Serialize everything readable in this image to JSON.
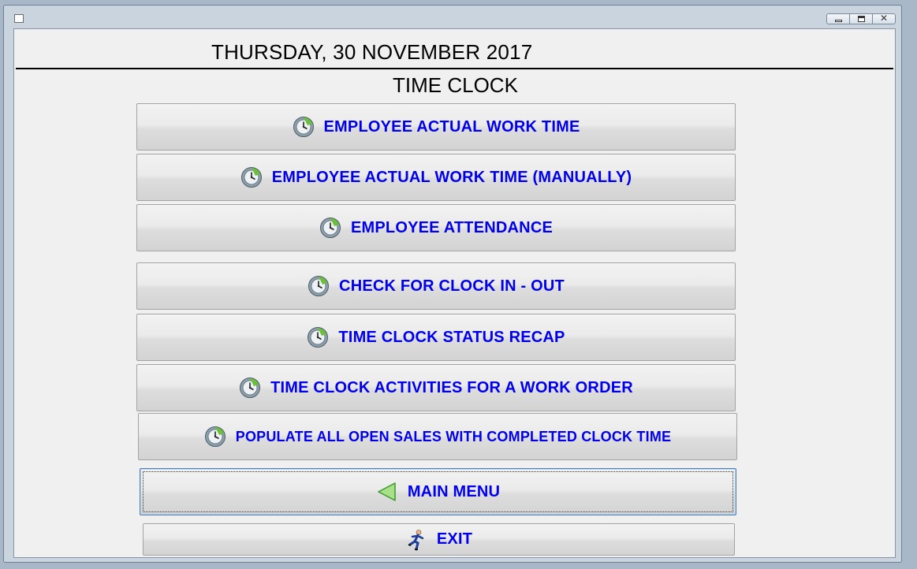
{
  "window": {
    "minimize_icon": "minimize-icon",
    "maximize_icon": "maximize-icon",
    "close_glyph": "✕"
  },
  "header": {
    "date": "THURSDAY, 30 NOVEMBER 2017",
    "title": "TIME CLOCK"
  },
  "menu": {
    "items": [
      {
        "label": "EMPLOYEE ACTUAL WORK TIME",
        "icon": "clock-icon"
      },
      {
        "label": "EMPLOYEE ACTUAL WORK TIME (MANUALLY)",
        "icon": "clock-icon"
      },
      {
        "label": "EMPLOYEE ATTENDANCE",
        "icon": "clock-icon"
      },
      {
        "label": "CHECK FOR CLOCK IN - OUT",
        "icon": "clock-icon"
      },
      {
        "label": "TIME CLOCK STATUS RECAP",
        "icon": "clock-icon"
      },
      {
        "label": "TIME CLOCK ACTIVITIES FOR A WORK ORDER",
        "icon": "clock-icon"
      },
      {
        "label": "POPULATE ALL OPEN SALES WITH COMPLETED CLOCK TIME",
        "icon": "clock-icon"
      }
    ],
    "main_menu": {
      "label": "MAIN MENU",
      "icon": "back-arrow-icon"
    },
    "exit": {
      "label": "EXIT",
      "icon": "running-man-icon"
    }
  },
  "colors": {
    "button_text": "#0000ee",
    "client_bg": "#f0f0f0",
    "window_frame": "#c9d4de"
  }
}
